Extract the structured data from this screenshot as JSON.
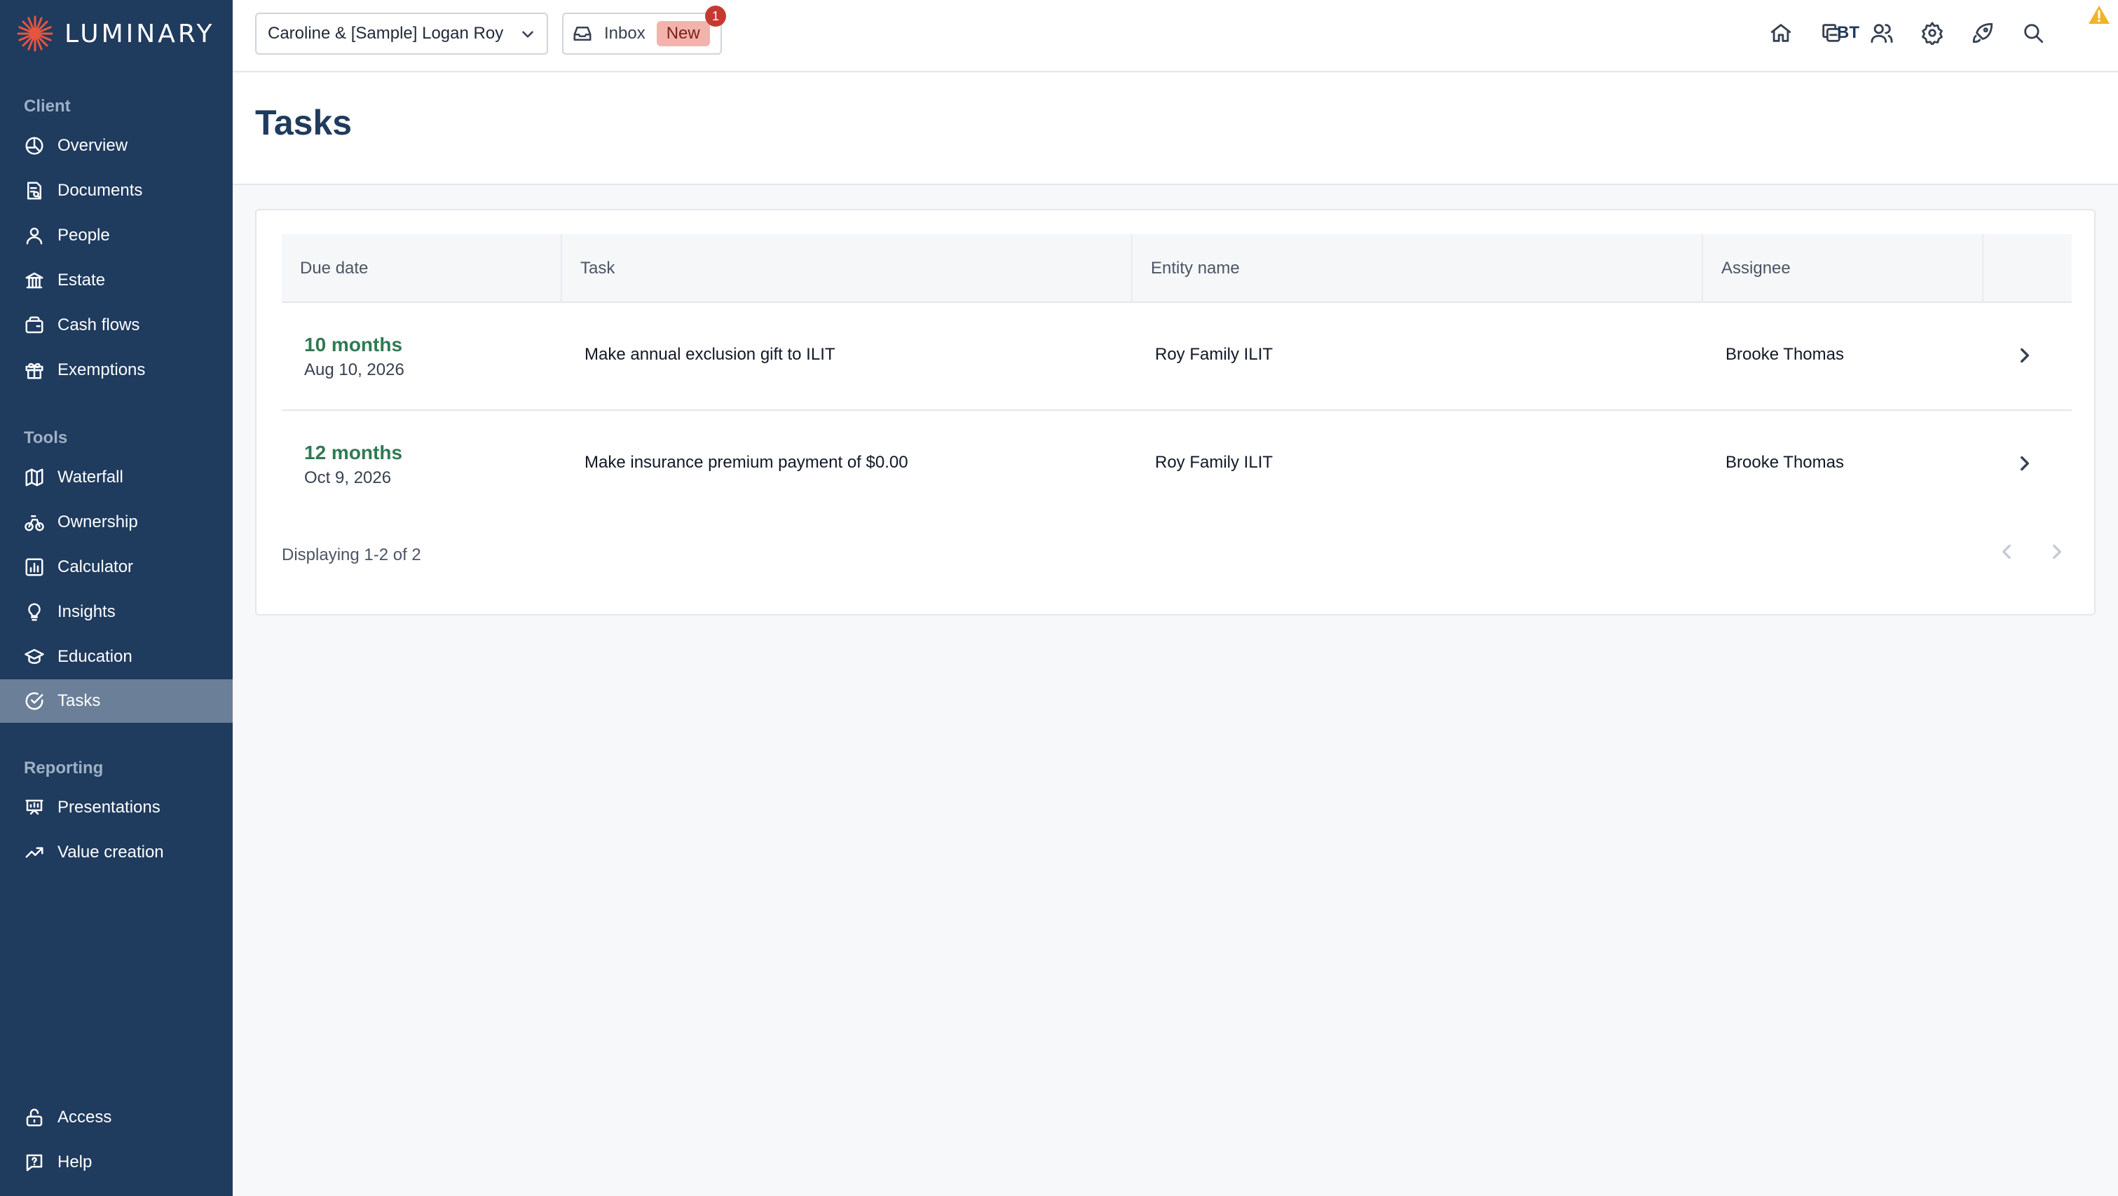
{
  "brand": {
    "name": "LUMINARY"
  },
  "sidebar": {
    "sections": [
      {
        "title": "Client"
      },
      {
        "title": "Tools"
      },
      {
        "title": "Reporting"
      }
    ],
    "client_items": [
      {
        "label": "Overview",
        "icon": "overview-icon"
      },
      {
        "label": "Documents",
        "icon": "documents-icon"
      },
      {
        "label": "People",
        "icon": "people-icon"
      },
      {
        "label": "Estate",
        "icon": "estate-icon"
      },
      {
        "label": "Cash flows",
        "icon": "wallet-icon"
      },
      {
        "label": "Exemptions",
        "icon": "gift-icon"
      }
    ],
    "tools_items": [
      {
        "label": "Waterfall",
        "icon": "map-icon"
      },
      {
        "label": "Ownership",
        "icon": "ownership-icon"
      },
      {
        "label": "Calculator",
        "icon": "calculator-icon"
      },
      {
        "label": "Insights",
        "icon": "lightbulb-icon"
      },
      {
        "label": "Education",
        "icon": "graduation-cap-icon"
      },
      {
        "label": "Tasks",
        "icon": "check-circle-icon",
        "active": true
      }
    ],
    "reporting_items": [
      {
        "label": "Presentations",
        "icon": "presentation-icon"
      },
      {
        "label": "Value creation",
        "icon": "trending-up-icon"
      }
    ],
    "bottom_items": [
      {
        "label": "Access",
        "icon": "lock-icon"
      },
      {
        "label": "Help",
        "icon": "help-icon"
      }
    ]
  },
  "topbar": {
    "client_select": "Caroline & [Sample] Logan Roy",
    "inbox_label": "Inbox",
    "inbox_badge": "New",
    "inbox_count": "1",
    "icons": [
      "home-icon",
      "copy-icon",
      "users-icon",
      "gear-icon",
      "rocket-icon",
      "search-icon"
    ],
    "avatar_initials": "BT"
  },
  "page": {
    "title": "Tasks"
  },
  "table": {
    "columns": [
      "Due date",
      "Task",
      "Entity name",
      "Assignee"
    ],
    "rows": [
      {
        "due_relative": "10 months",
        "due_date": "Aug 10, 2026",
        "task": "Make annual exclusion gift to ILIT",
        "entity": "Roy Family ILIT",
        "assignee": "Brooke Thomas"
      },
      {
        "due_relative": "12 months",
        "due_date": "Oct 9, 2026",
        "task": "Make insurance premium payment of $0.00",
        "entity": "Roy Family ILIT",
        "assignee": "Brooke Thomas"
      }
    ],
    "footer": "Displaying 1-2 of 2"
  },
  "colors": {
    "sidebar_bg": "#1f3b5e",
    "active_item_bg": "#6b7f98",
    "due_green": "#2f7a53",
    "badge_red": "#c53a30",
    "new_badge_bg": "#f3b3ad"
  }
}
